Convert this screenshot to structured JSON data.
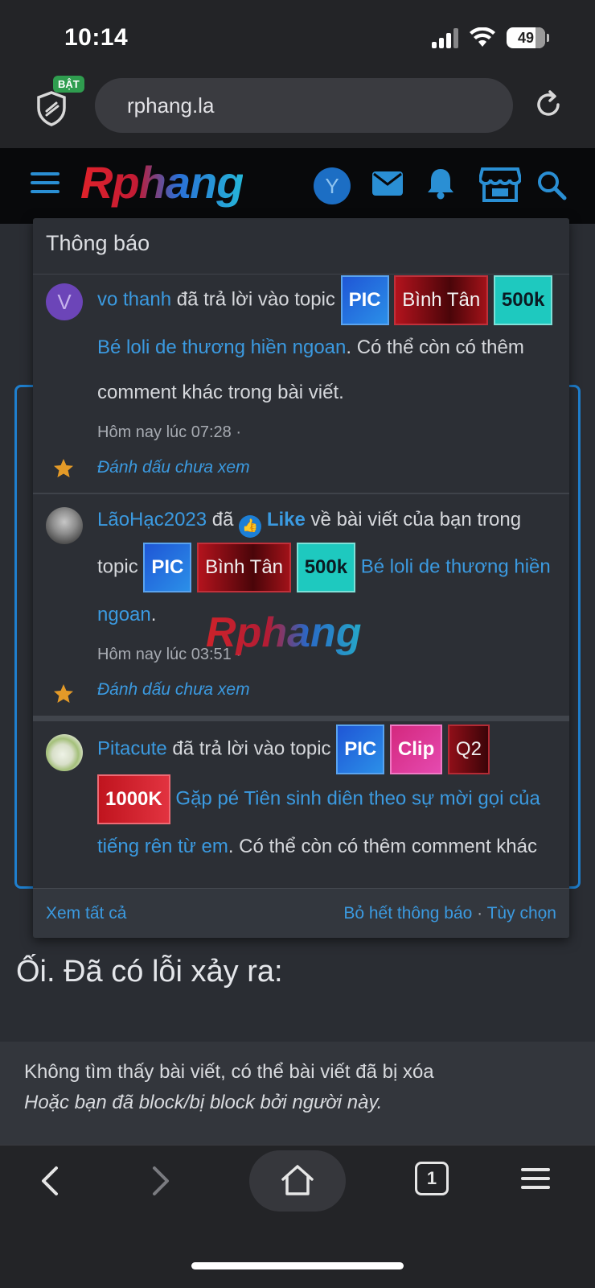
{
  "status_bar": {
    "time": "10:14",
    "battery": "49"
  },
  "browser": {
    "shield_badge": "BẬT",
    "url": "rphang.la"
  },
  "site": {
    "logo_text": "Rphang",
    "user_initial": "Y"
  },
  "notifications": {
    "title": "Thông báo",
    "items": [
      {
        "avatar_initial": "V",
        "user": "vo thanh",
        "action": "đã trả lời vào topic",
        "tags": [
          "PIC",
          "Bình Tân",
          "500k"
        ],
        "topic_title": "Bé loli de thương hiền ngoan",
        "suffix": ". Có thể còn có thêm comment khác trong bài viết.",
        "time": "Hôm nay lúc 07:28 ·",
        "mark_unread": "Đánh dấu chưa xem"
      },
      {
        "user": "LãoHạc2023",
        "action_pre": "đã",
        "like_word": "Like",
        "action_post": "về bài viết của bạn trong topic",
        "tags": [
          "PIC",
          "Bình Tân",
          "500k"
        ],
        "topic_title": "Bé loli de thương hiền ngoan",
        "suffix": ".",
        "time": "Hôm nay lúc 03:51 ·",
        "mark_unread": "Đánh dấu chưa xem"
      },
      {
        "user": "Pitacute",
        "action": "đã trả lời vào topic",
        "tags": [
          "PIC",
          "Clip",
          "Q2",
          "1000K"
        ],
        "topic_title": " Gặp pé Tiên sinh diên theo sự mời gọi của tiếng rên từ em",
        "suffix": ". Có thể còn có thêm comment khác trong bài viết."
      }
    ],
    "watermark": "Rphang",
    "footer": {
      "see_all": "Xem tất cả",
      "dismiss_all": "Bỏ hết thông báo",
      "separator": " · ",
      "options": "Tùy chọn"
    }
  },
  "main": {
    "error_title": "Ối. Đã có lỗi xảy ra:",
    "error_line1": "Không tìm thấy bài viết, có thể bài viết đã bị xóa",
    "error_line2": "Hoặc bạn đã block/bị block bởi người này."
  },
  "toolbar": {
    "tab_count": "1"
  },
  "colors": {
    "link": "#3b9ae0",
    "accent": "#1f7fce",
    "background": "#2a2d33"
  }
}
